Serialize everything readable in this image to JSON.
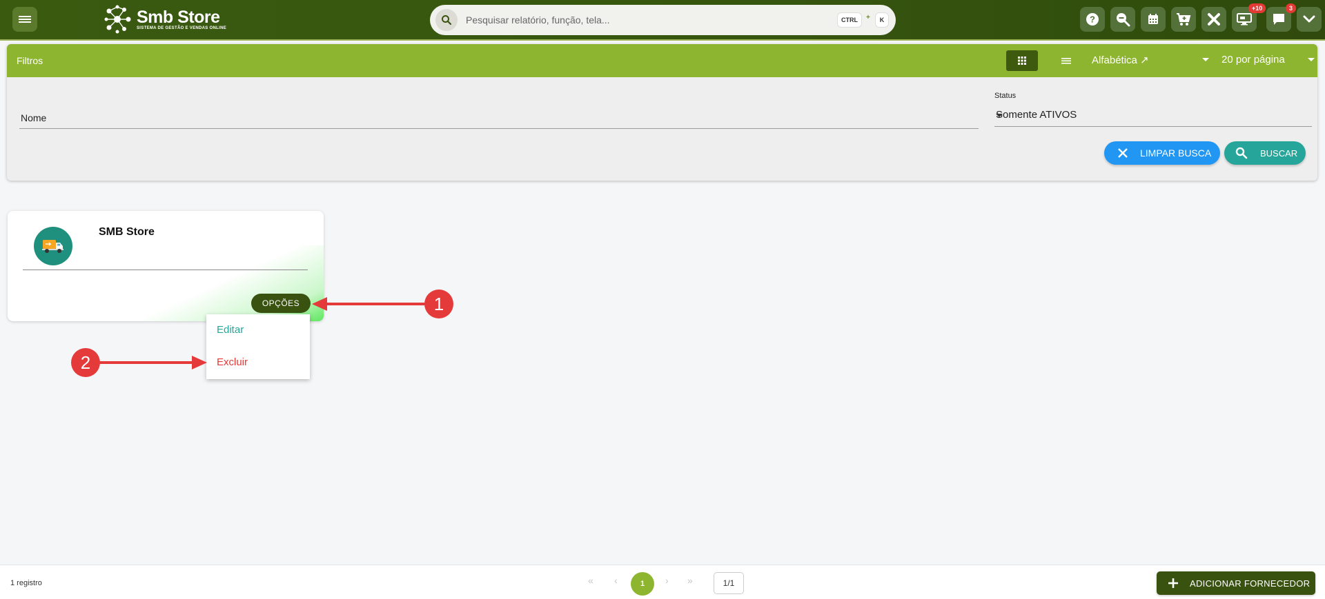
{
  "header": {
    "logo_title": "Smb Store",
    "logo_subtitle": "SISTEMA DE GESTÃO E VENDAS ONLINE",
    "search_placeholder": "Pesquisar relatório, função, tela...",
    "shortcut_ctrl": "CTRL",
    "shortcut_plus": "+",
    "shortcut_key": "K",
    "icons": [
      "help-icon",
      "zoom-search-icon",
      "calendar-icon",
      "cart-icon",
      "tools-icon",
      "monitor-icon",
      "chat-icon",
      "chevron-down-icon"
    ],
    "badge_monitor": "+10",
    "badge_chat": "3"
  },
  "filters": {
    "title": "Filtros",
    "sort_value": "Alfabética ↗",
    "per_page_value": "20 por página",
    "nome_label": "Nome",
    "status_label": "Status",
    "status_value": "Somente ATIVOS",
    "clear_label": "LIMPAR BUSCA",
    "search_label": "BUSCAR"
  },
  "card": {
    "title": "SMB Store",
    "options_label": "OPÇÕES",
    "menu": {
      "edit_label": "Editar",
      "delete_label": "Excluir"
    }
  },
  "annotations": {
    "marker_1": "1",
    "marker_2": "2"
  },
  "footer": {
    "records": "1 registro",
    "current_page": "1",
    "page_total": "1/1",
    "add_label": "ADICIONAR FORNECEDOR"
  },
  "colors": {
    "topbar": "#36550e",
    "filter_header": "#8db52f",
    "dark_green": "#3a5210",
    "blue": "#2196f3",
    "teal": "#26a69a",
    "red": "#e53935"
  }
}
